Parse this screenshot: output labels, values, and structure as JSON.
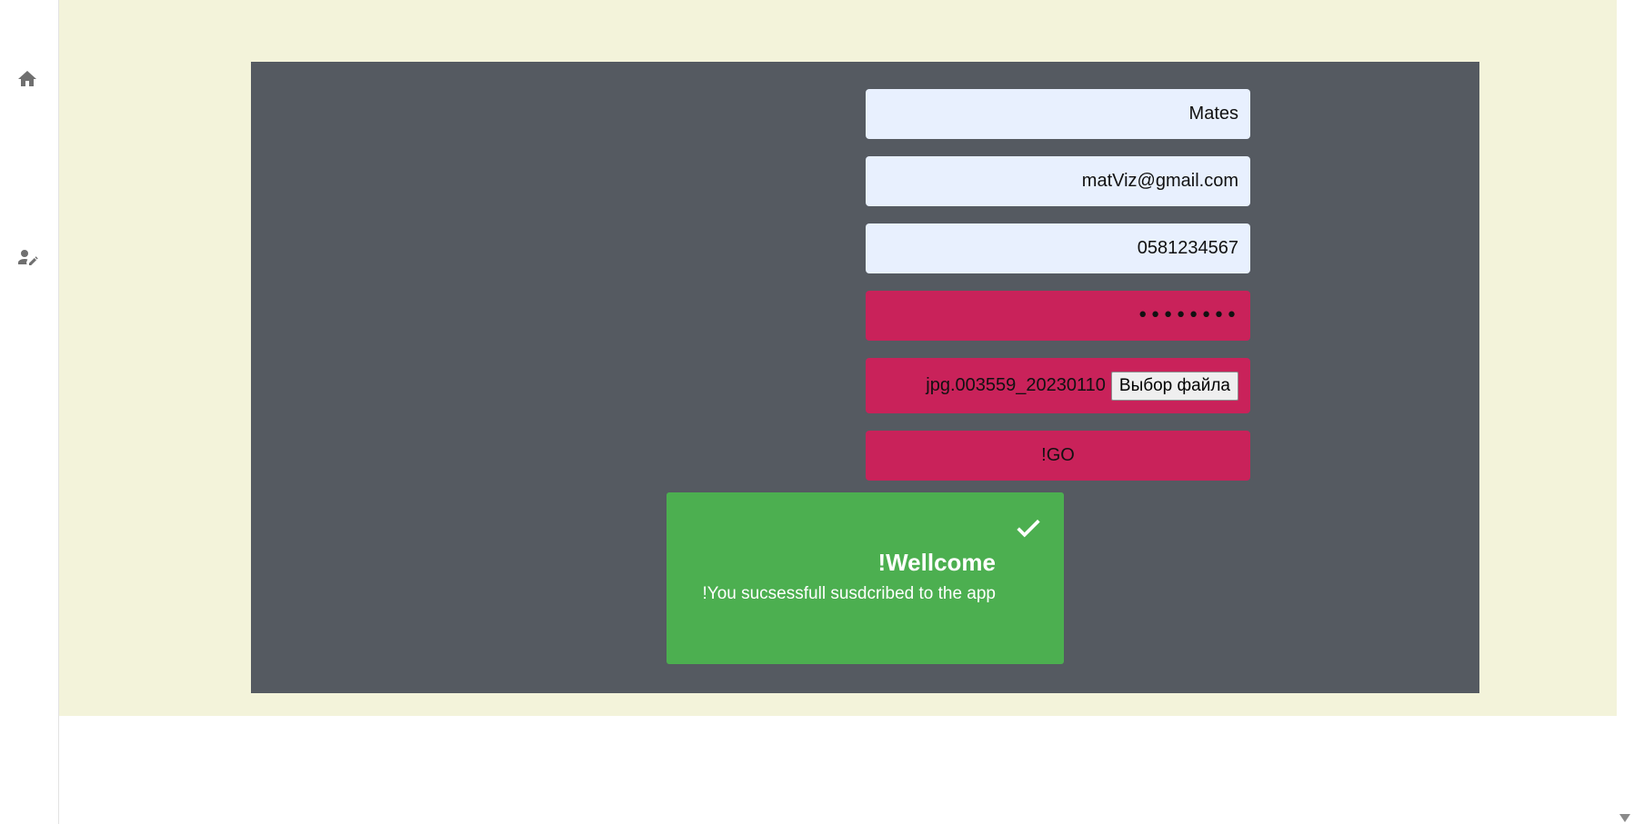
{
  "sidebar": {
    "items": [
      {
        "icon": "home-icon"
      },
      {
        "icon": "user-edit-icon"
      }
    ]
  },
  "form": {
    "name_value": "Mates",
    "email_value": "matViz@gmail.com",
    "phone_value": "0581234567",
    "password_value": "••••••••",
    "file_name": "jpg.003559_20230110",
    "file_button_label": "Выбор файла",
    "submit_label": "!GO"
  },
  "success_message": {
    "title": "!Wellcome",
    "text": "!You sucsessfull susdcribed to the app"
  },
  "colors": {
    "page_background": "#f3f3da",
    "panel_background": "#555a61",
    "input_light": "#e8f0fe",
    "input_accent": "#c9225a",
    "success": "#4caf50"
  }
}
